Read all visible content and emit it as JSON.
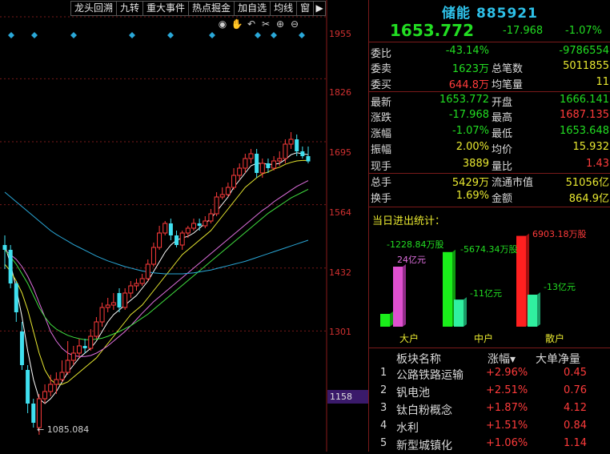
{
  "toolbar": {
    "buttons": [
      "龙头回溯",
      "九转",
      "重大事件",
      "热点掘金",
      "加自选",
      "均线",
      "窗"
    ],
    "arrow_icon": "arrow-right-icon"
  },
  "chart_icons": [
    "eye-icon",
    "hand-icon",
    "undo-icon",
    "scissors-icon",
    "plus-icon",
    "minus-icon"
  ],
  "price_axis": {
    "ticks": [
      "1955",
      "1826",
      "1695",
      "1564",
      "1432",
      "1301"
    ],
    "current_marker": "1158"
  },
  "chart_data": {
    "type": "candlestick",
    "ylim": [
      1050,
      1990
    ],
    "low_label": "1085.084",
    "candles": [
      {
        "o": 1480,
        "c": 1470,
        "h": 1500,
        "l": 1430
      },
      {
        "o": 1470,
        "c": 1400,
        "h": 1480,
        "l": 1390
      },
      {
        "o": 1400,
        "c": 1340,
        "h": 1405,
        "l": 1320
      },
      {
        "o": 1300,
        "c": 1230,
        "h": 1320,
        "l": 1220
      },
      {
        "o": 1220,
        "c": 1150,
        "h": 1230,
        "l": 1130
      },
      {
        "o": 1150,
        "c": 1110,
        "h": 1160,
        "l": 1100
      },
      {
        "o": 1100,
        "c": 1160,
        "h": 1170,
        "l": 1085
      },
      {
        "o": 1160,
        "c": 1175,
        "h": 1190,
        "l": 1150
      },
      {
        "o": 1175,
        "c": 1190,
        "h": 1210,
        "l": 1165
      },
      {
        "o": 1190,
        "c": 1200,
        "h": 1215,
        "l": 1170
      },
      {
        "o": 1200,
        "c": 1215,
        "h": 1240,
        "l": 1195
      },
      {
        "o": 1215,
        "c": 1240,
        "h": 1280,
        "l": 1210
      },
      {
        "o": 1240,
        "c": 1255,
        "h": 1270,
        "l": 1230
      },
      {
        "o": 1255,
        "c": 1270,
        "h": 1285,
        "l": 1245
      },
      {
        "o": 1270,
        "c": 1265,
        "h": 1285,
        "l": 1255
      },
      {
        "o": 1265,
        "c": 1290,
        "h": 1305,
        "l": 1260
      },
      {
        "o": 1290,
        "c": 1320,
        "h": 1330,
        "l": 1285
      },
      {
        "o": 1320,
        "c": 1350,
        "h": 1360,
        "l": 1310
      },
      {
        "o": 1350,
        "c": 1355,
        "h": 1370,
        "l": 1340
      },
      {
        "o": 1355,
        "c": 1360,
        "h": 1380,
        "l": 1345
      },
      {
        "o": 1380,
        "c": 1350,
        "h": 1390,
        "l": 1340
      },
      {
        "o": 1350,
        "c": 1380,
        "h": 1390,
        "l": 1345
      },
      {
        "o": 1380,
        "c": 1395,
        "h": 1405,
        "l": 1370
      },
      {
        "o": 1395,
        "c": 1400,
        "h": 1410,
        "l": 1385
      },
      {
        "o": 1400,
        "c": 1410,
        "h": 1420,
        "l": 1395
      },
      {
        "o": 1410,
        "c": 1440,
        "h": 1450,
        "l": 1405
      },
      {
        "o": 1440,
        "c": 1475,
        "h": 1485,
        "l": 1435
      },
      {
        "o": 1475,
        "c": 1505,
        "h": 1520,
        "l": 1470
      },
      {
        "o": 1505,
        "c": 1525,
        "h": 1530,
        "l": 1500
      },
      {
        "o": 1525,
        "c": 1500,
        "h": 1535,
        "l": 1490
      },
      {
        "o": 1500,
        "c": 1480,
        "h": 1510,
        "l": 1475
      },
      {
        "o": 1480,
        "c": 1505,
        "h": 1510,
        "l": 1470
      },
      {
        "o": 1505,
        "c": 1515,
        "h": 1520,
        "l": 1495
      },
      {
        "o": 1515,
        "c": 1525,
        "h": 1535,
        "l": 1510
      },
      {
        "o": 1525,
        "c": 1520,
        "h": 1535,
        "l": 1510
      },
      {
        "o": 1520,
        "c": 1530,
        "h": 1540,
        "l": 1515
      },
      {
        "o": 1530,
        "c": 1545,
        "h": 1555,
        "l": 1525
      },
      {
        "o": 1545,
        "c": 1580,
        "h": 1590,
        "l": 1540
      },
      {
        "o": 1580,
        "c": 1585,
        "h": 1600,
        "l": 1575
      },
      {
        "o": 1585,
        "c": 1600,
        "h": 1610,
        "l": 1580
      },
      {
        "o": 1600,
        "c": 1625,
        "h": 1640,
        "l": 1595
      },
      {
        "o": 1625,
        "c": 1640,
        "h": 1650,
        "l": 1615
      },
      {
        "o": 1640,
        "c": 1660,
        "h": 1670,
        "l": 1630
      },
      {
        "o": 1660,
        "c": 1670,
        "h": 1680,
        "l": 1650
      },
      {
        "o": 1670,
        "c": 1630,
        "h": 1680,
        "l": 1620
      },
      {
        "o": 1630,
        "c": 1650,
        "h": 1660,
        "l": 1620
      },
      {
        "o": 1650,
        "c": 1640,
        "h": 1660,
        "l": 1630
      },
      {
        "o": 1640,
        "c": 1655,
        "h": 1665,
        "l": 1635
      },
      {
        "o": 1655,
        "c": 1660,
        "h": 1675,
        "l": 1645
      },
      {
        "o": 1660,
        "c": 1690,
        "h": 1700,
        "l": 1650
      },
      {
        "o": 1690,
        "c": 1700,
        "h": 1715,
        "l": 1680
      },
      {
        "o": 1700,
        "c": 1675,
        "h": 1710,
        "l": 1665
      },
      {
        "o": 1675,
        "c": 1665,
        "h": 1685,
        "l": 1660
      },
      {
        "o": 1665,
        "c": 1654,
        "h": 1685,
        "l": 1650
      }
    ],
    "ma_lines": [
      {
        "name": "MA5",
        "color": "#ffffff",
        "values": [
          1480,
          1440,
          1390,
          1330,
          1260,
          1200,
          1160,
          1150,
          1160,
          1175,
          1195,
          1215,
          1230,
          1245,
          1255,
          1265,
          1280,
          1300,
          1320,
          1335,
          1345,
          1355,
          1365,
          1375,
          1390,
          1405,
          1425,
          1445,
          1465,
          1480,
          1490,
          1495,
          1498,
          1505,
          1515,
          1525,
          1535,
          1550,
          1565,
          1580,
          1600,
          1615,
          1630,
          1645,
          1650,
          1650,
          1648,
          1648,
          1650,
          1658,
          1668,
          1672,
          1670,
          1668
        ]
      },
      {
        "name": "MA10",
        "color": "#e8e830",
        "values": [
          1440,
          1425,
          1405,
          1380,
          1345,
          1300,
          1255,
          1220,
          1200,
          1190,
          1190,
          1195,
          1205,
          1215,
          1225,
          1235,
          1245,
          1260,
          1275,
          1290,
          1305,
          1320,
          1335,
          1345,
          1355,
          1370,
          1385,
          1400,
          1415,
          1430,
          1445,
          1460,
          1470,
          1480,
          1490,
          1500,
          1510,
          1525,
          1540,
          1555,
          1570,
          1585,
          1600,
          1610,
          1620,
          1628,
          1632,
          1638,
          1642,
          1648,
          1652,
          1655,
          1656,
          1656
        ]
      },
      {
        "name": "MA20",
        "color": "#e070e0",
        "values": [
          1470,
          1460,
          1450,
          1435,
          1415,
          1390,
          1360,
          1330,
          1300,
          1280,
          1265,
          1255,
          1250,
          1248,
          1248,
          1250,
          1255,
          1262,
          1270,
          1280,
          1290,
          1300,
          1312,
          1325,
          1338,
          1350,
          1362,
          1372,
          1382,
          1392,
          1402,
          1412,
          1422,
          1432,
          1442,
          1452,
          1462,
          1472,
          1482,
          1492,
          1502,
          1512,
          1522,
          1532,
          1542,
          1552,
          1560,
          1570,
          1578,
          1586,
          1594,
          1602,
          1608,
          1614
        ]
      },
      {
        "name": "MA30",
        "color": "#40e040",
        "values": [
          1470,
          1455,
          1440,
          1420,
          1400,
          1375,
          1350,
          1330,
          1315,
          1305,
          1298,
          1292,
          1288,
          1285,
          1283,
          1283,
          1284,
          1286,
          1290,
          1295,
          1300,
          1306,
          1312,
          1320,
          1328,
          1336,
          1346,
          1356,
          1366,
          1376,
          1386,
          1396,
          1406,
          1416,
          1426,
          1436,
          1446,
          1456,
          1466,
          1476,
          1486,
          1496,
          1506,
          1516,
          1526,
          1536,
          1546,
          1554,
          1562,
          1570,
          1578,
          1584,
          1590,
          1596
        ]
      },
      {
        "name": "MA60",
        "color": "#2aa8d8",
        "values": [
          1590,
          1580,
          1570,
          1560,
          1550,
          1540,
          1530,
          1520,
          1510,
          1502,
          1495,
          1488,
          1481,
          1475,
          1469,
          1463,
          1457,
          1452,
          1447,
          1443,
          1439,
          1435,
          1432,
          1429,
          1426,
          1424,
          1422,
          1421,
          1420,
          1420,
          1420,
          1420,
          1421,
          1422,
          1424,
          1426,
          1428,
          1431,
          1434,
          1437,
          1440,
          1443,
          1446,
          1450,
          1454,
          1458,
          1462,
          1466,
          1470,
          1474,
          1478,
          1482,
          1486,
          1490
        ]
      }
    ]
  },
  "quote": {
    "name": "储能",
    "code": "885921",
    "price": "1653.772",
    "change": "-17.968",
    "change_pct": "-1.07%",
    "rows": [
      {
        "l1": "委比",
        "v1": "-43.14%",
        "c1": "g",
        "l2": "",
        "v2": "-9786554",
        "c2": "g"
      },
      {
        "l1": "委卖",
        "v1": "1623万",
        "c1": "g",
        "l2": "总笔数",
        "v2": "5011855",
        "c2": "y"
      },
      {
        "l1": "委买",
        "v1": "644.8万",
        "c1": "r",
        "l2": "均笔量",
        "v2": "11",
        "c2": "y"
      },
      {
        "l1": "最新",
        "v1": "1653.772",
        "c1": "g",
        "l2": "开盘",
        "v2": "1666.141",
        "c2": "g"
      },
      {
        "l1": "涨跌",
        "v1": "-17.968",
        "c1": "g",
        "l2": "最高",
        "v2": "1687.135",
        "c2": "r"
      },
      {
        "l1": "涨幅",
        "v1": "-1.07%",
        "c1": "g",
        "l2": "最低",
        "v2": "1653.648",
        "c2": "g"
      },
      {
        "l1": "振幅",
        "v1": "2.00%",
        "c1": "y",
        "l2": "均价",
        "v2": "15.932",
        "c2": "y"
      },
      {
        "l1": "现手",
        "v1": "3889",
        "c1": "y",
        "l2": "量比",
        "v2": "1.43",
        "c2": "r"
      },
      {
        "l1": "总手",
        "v1": "5429万",
        "c1": "y",
        "l2": "流通市值",
        "v2": "51056亿",
        "c2": "y"
      },
      {
        "l1": "换手",
        "v1": "1.69%",
        "c1": "y",
        "l2": "金额",
        "v2": "864.9亿",
        "c2": "y"
      }
    ]
  },
  "flow": {
    "title": "当日进出统计：",
    "categories": [
      {
        "name": "大户",
        "vol_label": "-1228.84万股",
        "vol_color": "#22dd22",
        "amt_label": "24亿元",
        "amt_color": "#e070e0",
        "bar_vol": -1228.84,
        "bar_amt": 24
      },
      {
        "name": "中户",
        "vol_label": "-5674.34万股",
        "vol_color": "#22dd22",
        "amt_label": "-11亿元",
        "amt_color": "#22dd22",
        "bar_vol": -5674.34,
        "bar_amt": -11
      },
      {
        "name": "散户",
        "vol_label": "6903.18万股",
        "vol_color": "#ff3b3b",
        "amt_label": "-13亿元",
        "amt_color": "#22dd22",
        "bar_vol": 6903.18,
        "bar_amt": -13
      }
    ]
  },
  "sectors": {
    "headers": [
      "板块名称",
      "涨幅",
      "大单净量"
    ],
    "sort_icon": "sort-down-icon",
    "rows": [
      {
        "idx": "1",
        "name": "公路铁路运输",
        "pct": "+2.96%",
        "net": "0.45"
      },
      {
        "idx": "2",
        "name": "钒电池",
        "pct": "+2.51%",
        "net": "0.76"
      },
      {
        "idx": "3",
        "name": "钛白粉概念",
        "pct": "+1.87%",
        "net": "4.12"
      },
      {
        "idx": "4",
        "name": "水利",
        "pct": "+1.51%",
        "net": "0.84"
      },
      {
        "idx": "5",
        "name": "新型城镇化",
        "pct": "+1.06%",
        "net": "1.14"
      }
    ]
  }
}
